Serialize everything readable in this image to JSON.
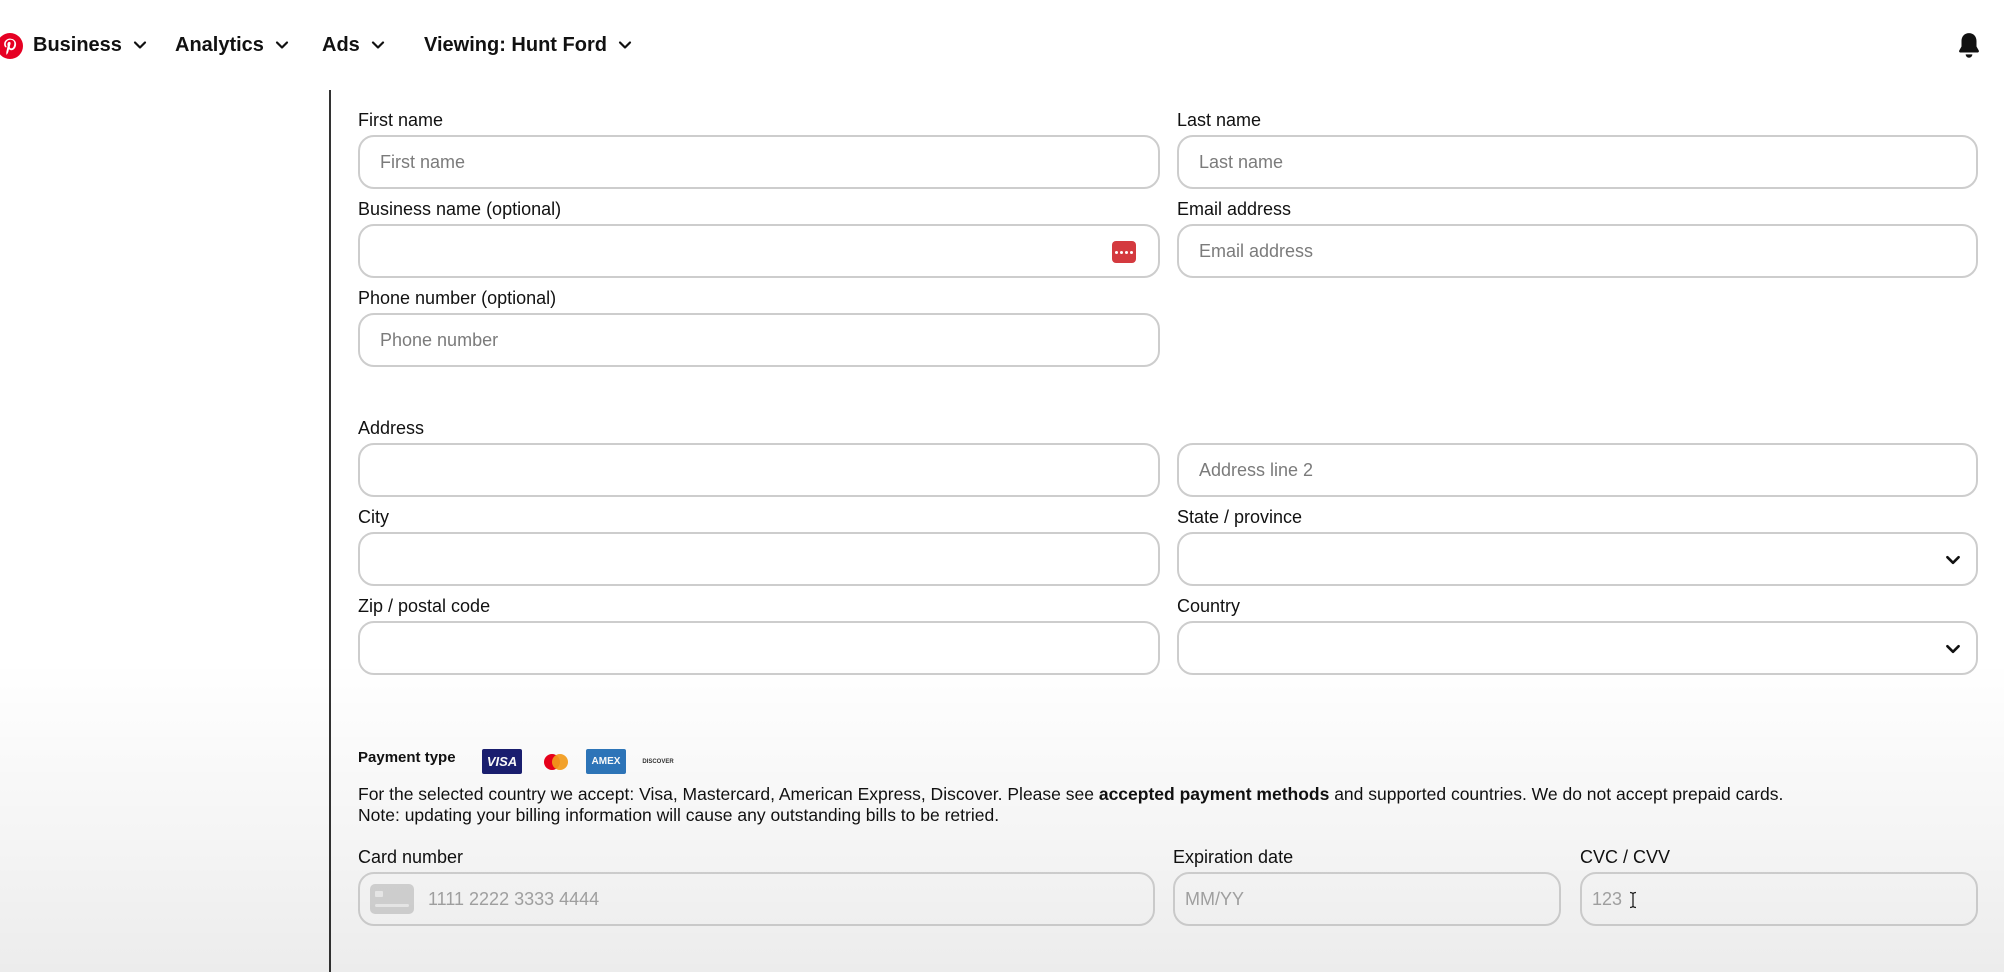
{
  "nav": {
    "items": [
      {
        "label": "Business",
        "icon": "chevron-down-icon"
      },
      {
        "label": "Analytics",
        "icon": "chevron-down-icon"
      },
      {
        "label": "Ads",
        "icon": "chevron-down-icon"
      },
      {
        "label": "Viewing: Hunt Ford",
        "icon": "chevron-down-icon"
      }
    ],
    "logo_icon": "pinterest-logo-icon",
    "notification_icon": "bell-icon",
    "brand_color": "#e60023"
  },
  "form": {
    "first_name": {
      "label": "First name",
      "placeholder": "First name",
      "value": ""
    },
    "last_name": {
      "label": "Last name",
      "placeholder": "Last name",
      "value": ""
    },
    "business_name": {
      "label": "Business name (optional)",
      "placeholder": "",
      "value": "",
      "icon": "password-manager-icon"
    },
    "email": {
      "label": "Email address",
      "placeholder": "Email address",
      "value": ""
    },
    "phone": {
      "label": "Phone number (optional)",
      "placeholder": "Phone number",
      "value": ""
    },
    "address": {
      "label": "Address",
      "placeholder": "",
      "value": ""
    },
    "address2": {
      "placeholder": "Address line 2",
      "value": ""
    },
    "city": {
      "label": "City",
      "placeholder": "",
      "value": ""
    },
    "state": {
      "label": "State / province",
      "value": "",
      "icon": "chevron-down-icon"
    },
    "zip": {
      "label": "Zip / postal code",
      "placeholder": "",
      "value": ""
    },
    "country": {
      "label": "Country",
      "value": "",
      "icon": "chevron-down-icon"
    }
  },
  "payment": {
    "title": "Payment type",
    "cards": [
      "VISA",
      "mastercard",
      "AMEX",
      "DISCOVER"
    ],
    "notice_part1": "For the selected country we accept: Visa, Mastercard, American Express, Discover. Please see ",
    "notice_link": "accepted payment methods",
    "notice_part2": " and supported countries. We do not accept prepaid cards.",
    "notice_line2": "Note: updating your billing information will cause any outstanding bills to be retried.",
    "card_number": {
      "label": "Card number",
      "placeholder": "1111 2222 3333 4444",
      "icon": "credit-card-icon"
    },
    "expiration": {
      "label": "Expiration date",
      "placeholder": "MM/YY"
    },
    "cvc": {
      "label": "CVC / CVV",
      "placeholder": "123"
    }
  },
  "colors": {
    "visa_blue": "#1a1f71",
    "amex_blue": "#2e77bc",
    "password_badge": "#d43a3f"
  }
}
